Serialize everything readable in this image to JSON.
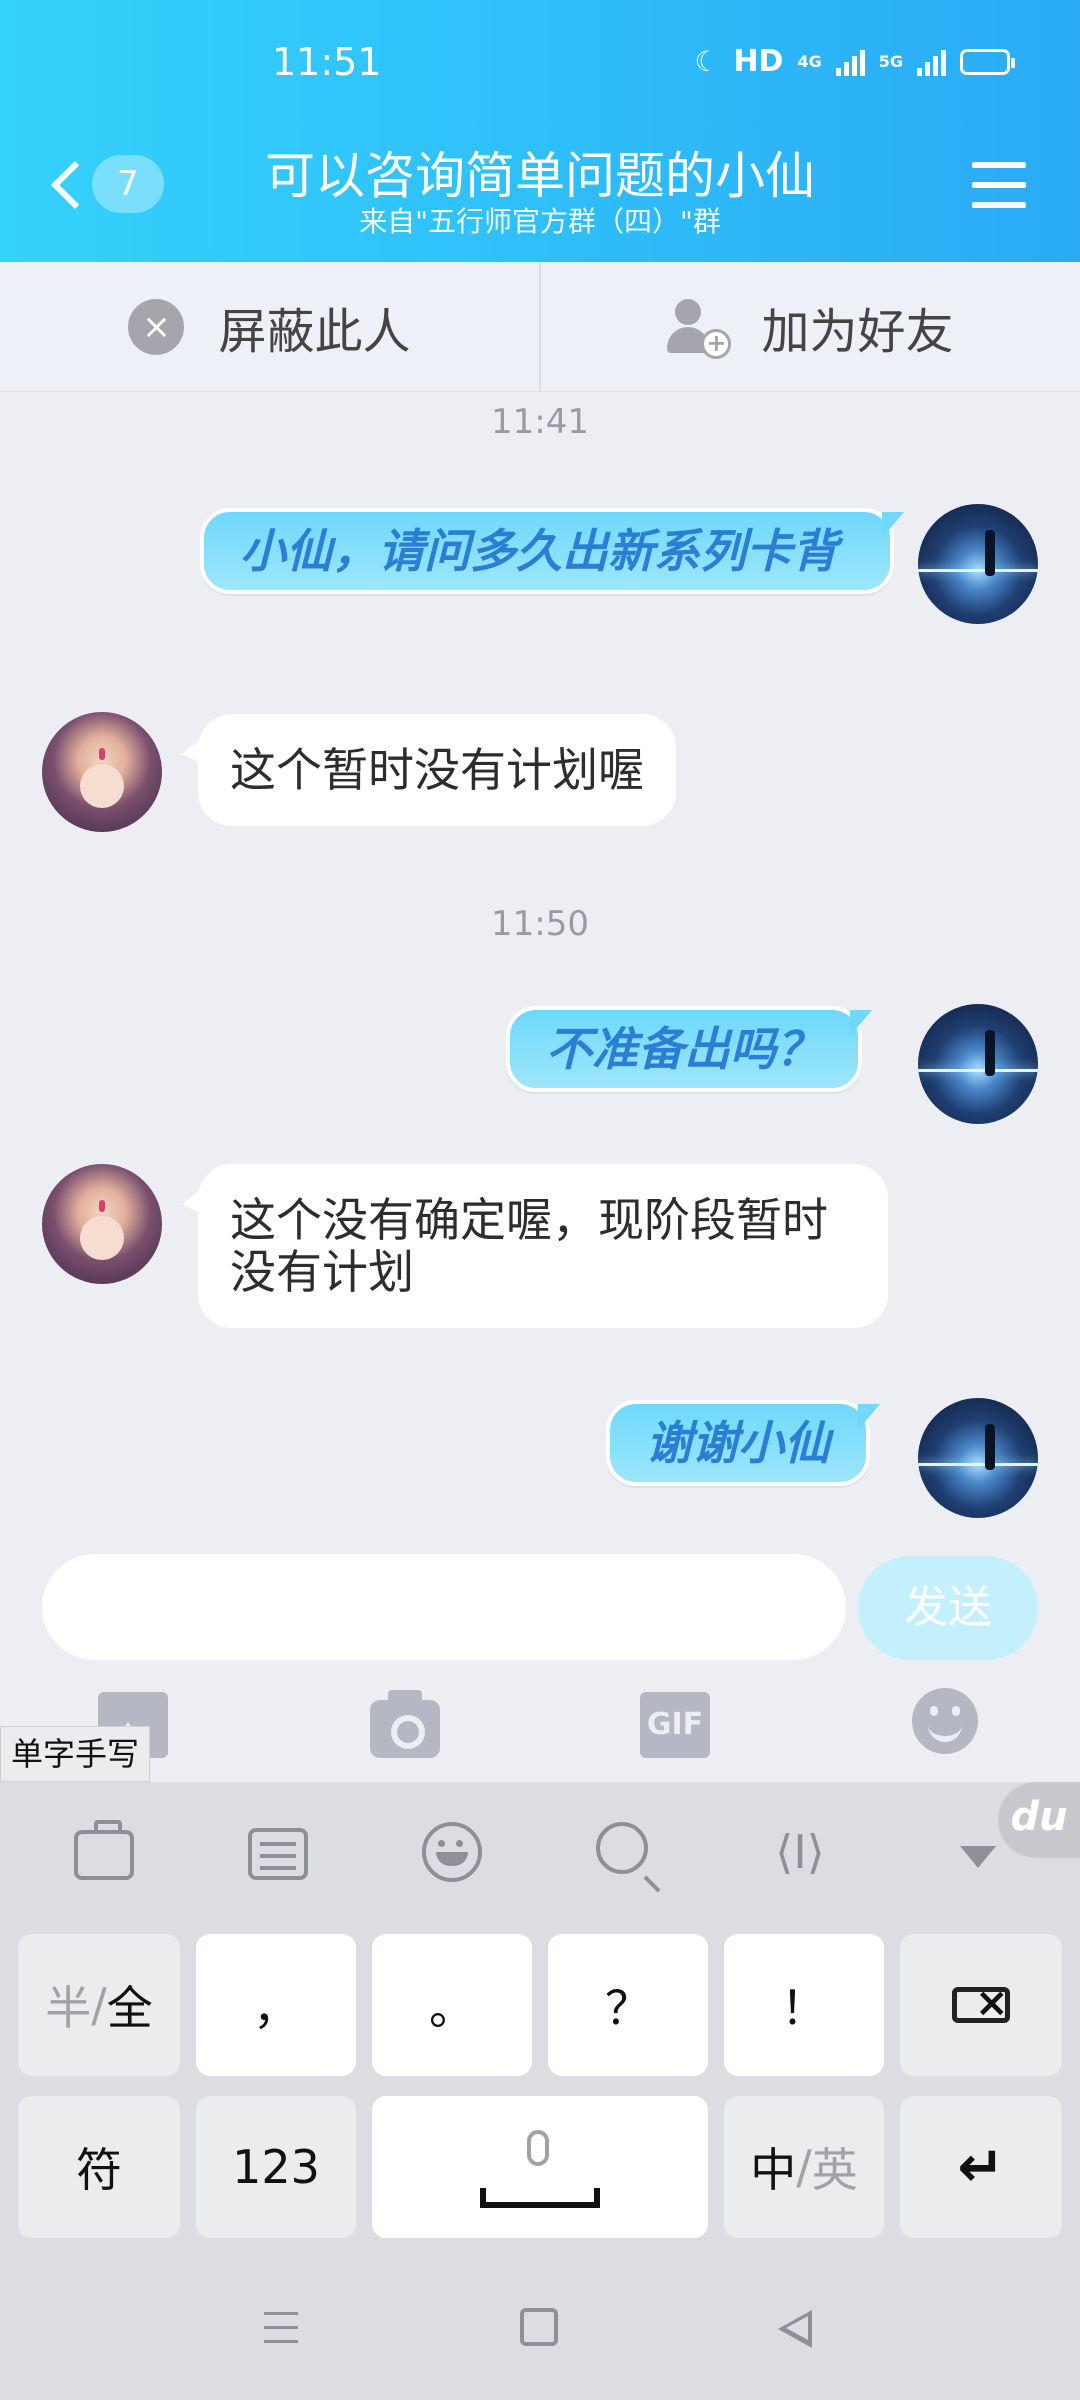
{
  "status_bar": {
    "time": "11:51",
    "hd": "HD",
    "net1": "4G",
    "net2": "5G"
  },
  "header": {
    "unread_count": "7",
    "title": "可以咨询简单问题的小仙",
    "subtitle": "来自\"五行师官方群（四）\"群"
  },
  "actions": {
    "block": "屏蔽此人",
    "add_friend": "加为好友"
  },
  "messages": [
    {
      "type": "time",
      "text": "11:41"
    },
    {
      "from": "me",
      "text": "小仙，请问多久出新系列卡背"
    },
    {
      "from": "her",
      "text": "这个暂时没有计划喔"
    },
    {
      "type": "time",
      "text": "11:50"
    },
    {
      "from": "me",
      "text": "不准备出吗？"
    },
    {
      "from": "her",
      "text": "这个没有确定喔，现阶段暂时没有计划"
    },
    {
      "from": "me",
      "text": "谢谢小仙"
    }
  ],
  "input": {
    "value": "",
    "placeholder": "",
    "send": "发送"
  },
  "tools": {
    "gif": "GIF"
  },
  "handwrite_tag": "单字手写",
  "keyboard": {
    "logo": "du",
    "cursor": "⟨I⟩",
    "row1": {
      "halfwidth_a": "半",
      "sep": "/",
      "halfwidth_b": "全",
      "comma": "，",
      "period": "。",
      "question": "？",
      "exclaim": "！"
    },
    "row2": {
      "symbol": "符",
      "num": "123",
      "lang_a": "中",
      "lang_sep": "/",
      "lang_b": "英",
      "enter": "↵"
    }
  },
  "colors": {
    "header_start": "#35d2fb",
    "header_end": "#2aaaf5",
    "my_bubble": "#6fd8fb",
    "my_text": "#2a7ed4",
    "send_btn": "#c4f0fd"
  }
}
